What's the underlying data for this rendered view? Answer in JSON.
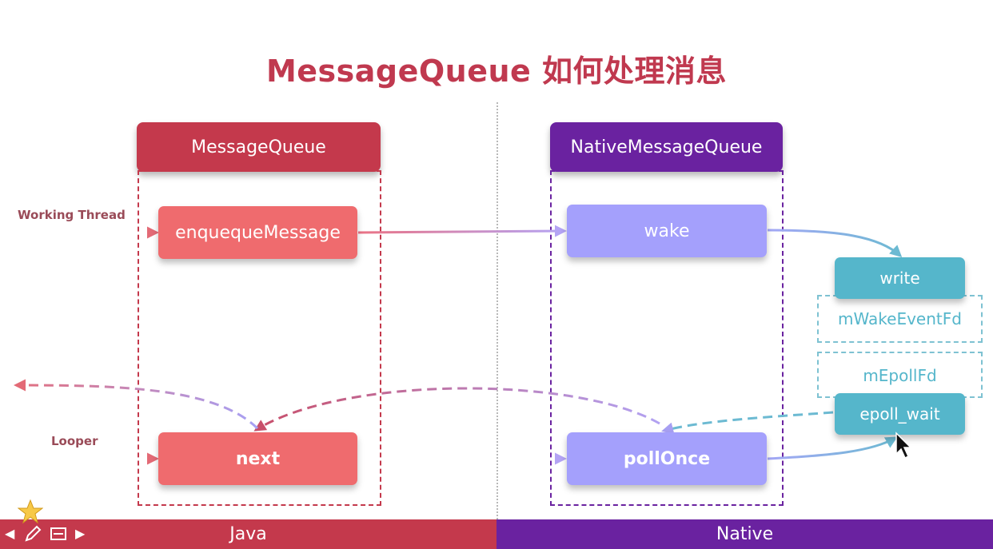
{
  "title": "MessageQueue 如何处理消息",
  "java_panel": {
    "header": "MessageQueue",
    "band": "Java"
  },
  "native_panel": {
    "header": "NativeMessageQueue",
    "band": "Native"
  },
  "labels": {
    "working_thread": "Working Thread",
    "looper": "Looper"
  },
  "nodes": {
    "enqueue": "enquequeMessage",
    "next": "next",
    "wake": "wake",
    "poll_once": "pollOnce",
    "write": "write",
    "epoll_wait": "epoll_wait"
  },
  "fds": {
    "wake_event": "mWakeEventFd",
    "epoll": "mEpollFd"
  },
  "colors": {
    "java": "#c4394c",
    "native": "#6a22a0",
    "java_node": "#ef6b6e",
    "native_node": "#a4a0fc",
    "fd_node": "#55b6cb"
  },
  "icons": [
    "star-icon",
    "arrow-left-icon",
    "pencil-icon",
    "slides-icon",
    "arrow-right-icon"
  ]
}
